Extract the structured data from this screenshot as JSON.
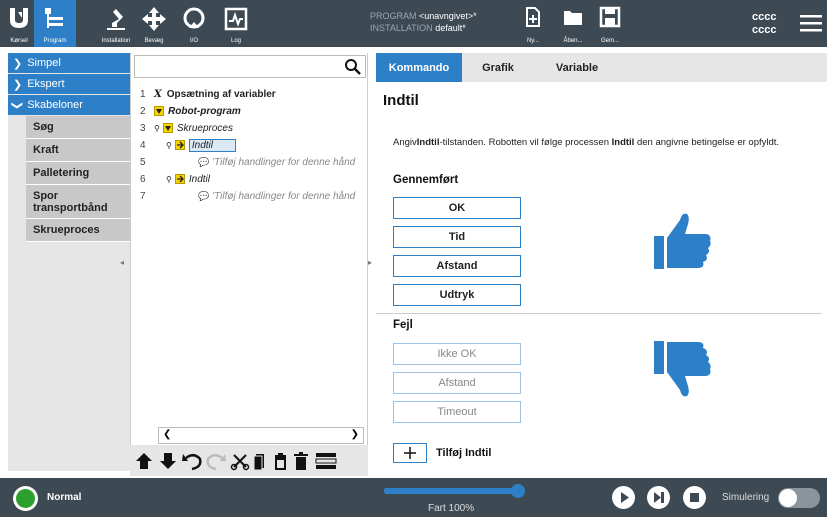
{
  "topbar": {
    "tabs": [
      {
        "label": "Kørsel",
        "icon": "ur-logo-icon"
      },
      {
        "label": "Program",
        "icon": "program-icon"
      },
      {
        "label": "Installation",
        "icon": "robot-arm-icon"
      },
      {
        "label": "Bevæg",
        "icon": "move-arrows-icon"
      },
      {
        "label": "I/O",
        "icon": "io-icon"
      },
      {
        "label": "Log",
        "icon": "log-icon"
      }
    ],
    "program_label": "PROGRAM",
    "program_value": "<unavngivet>*",
    "installation_label": "INSTALLATION",
    "installation_value": "default*",
    "file_actions": [
      {
        "label": "Ny...",
        "icon": "new-file-icon"
      },
      {
        "label": "Åben...",
        "icon": "open-folder-icon"
      },
      {
        "label": "Gem...",
        "icon": "save-icon"
      }
    ],
    "user_line1": "cccc",
    "user_line2": "cccc"
  },
  "sidemenu": {
    "sections": [
      {
        "label": "Simpel",
        "expanded": false
      },
      {
        "label": "Ekspert",
        "expanded": false
      },
      {
        "label": "Skabeloner",
        "expanded": true
      }
    ],
    "items": [
      "Søg",
      "Kraft",
      "Palletering",
      "Spor transportbånd",
      "Skrueproces"
    ]
  },
  "tree": {
    "rows": [
      {
        "num": "1",
        "text": "Opsætning af variabler"
      },
      {
        "num": "2",
        "text": "Robot-program"
      },
      {
        "num": "3",
        "text": "Skrueproces"
      },
      {
        "num": "4",
        "text": "Indtil"
      },
      {
        "num": "5",
        "text": "'Tilføj handlinger for denne hånd"
      },
      {
        "num": "6",
        "text": "Indtil"
      },
      {
        "num": "7",
        "text": "'Tilføj handlinger for denne hånd"
      }
    ]
  },
  "right": {
    "tabs": [
      "Kommando",
      "Grafik",
      "Variable"
    ],
    "title": "Indtil",
    "desc_part1": "Angiv",
    "desc_bold1": "Indtil",
    "desc_part2": "-tilstanden. Robotten vil følge processen ",
    "desc_bold2": "Indtil",
    "desc_part3": " den angivne betingelse er opfyldt.",
    "completed_heading": "Gennemført",
    "completed_buttons": [
      "OK",
      "Tid",
      "Afstand",
      "Udtryk"
    ],
    "error_heading": "Fejl",
    "error_buttons": [
      "Ikke OK",
      "Afstand",
      "Timeout"
    ],
    "add_label": "Tilføj Indtil",
    "accent": "#2d7fc7",
    "thumb_color": "#2d7fc7"
  },
  "bottombar": {
    "status": "Normal",
    "status_color": "#2ca02c",
    "speed_label": "Fart 100%",
    "speed_fraction": 1.0,
    "simulation_label": "Simulering"
  }
}
